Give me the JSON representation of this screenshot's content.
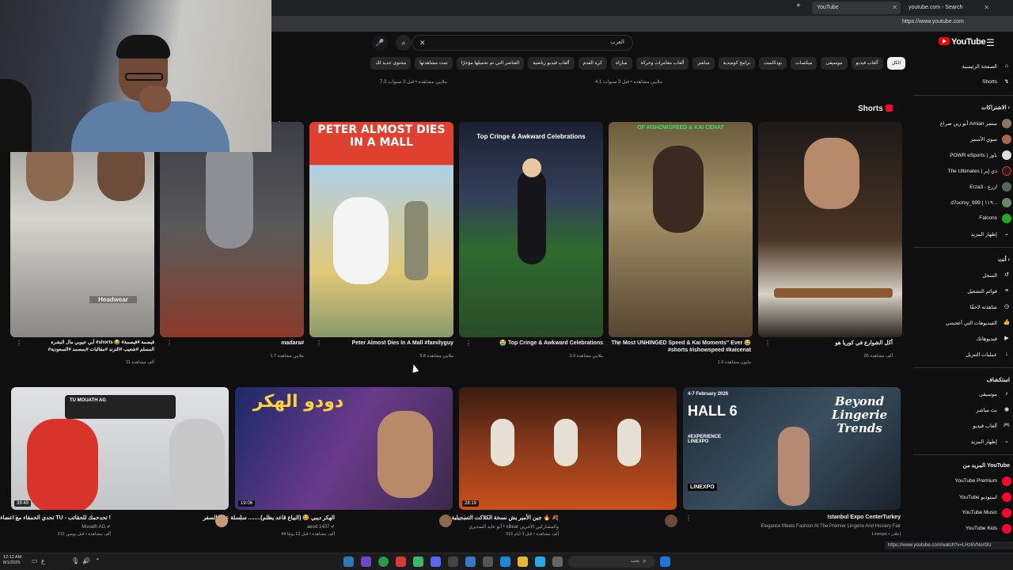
{
  "browser": {
    "tabs": [
      {
        "label": "YouTube",
        "active": true
      },
      {
        "label": "youtube.com - Search",
        "active": false
      }
    ],
    "new_tab": "+",
    "url": "https://www.youtube.com"
  },
  "header": {
    "logo": "YouTube",
    "search_value": "العرب",
    "clear_icon": "✕",
    "search_icon": "⌕",
    "mic_icon": "🎤",
    "menu_icon": "☰"
  },
  "chips": [
    {
      "label": "الكل",
      "active": true
    },
    {
      "label": "ألعاب فيديو",
      "active": false
    },
    {
      "label": "موسيقى",
      "active": false
    },
    {
      "label": "ميكسات",
      "active": false
    },
    {
      "label": "بودكاست",
      "active": false
    },
    {
      "label": "برامج كوميدية",
      "active": false
    },
    {
      "label": "مباشر",
      "active": false
    },
    {
      "label": "ألعاب مغامرات وحركة",
      "active": false
    },
    {
      "label": "مباراة",
      "active": false
    },
    {
      "label": "كرة القدم",
      "active": false
    },
    {
      "label": "ألعاب فيديو رياضية",
      "active": false
    },
    {
      "label": "العناصر التي تم تحميلها مؤخرًا",
      "active": false
    },
    {
      "label": "تمت مشاهدتها",
      "active": false
    },
    {
      "label": "محتوى جديد لك",
      "active": false
    }
  ],
  "prev_row": [
    {
      "meta": "7.3 ملايين مشاهدة • قبل 3 سنوات"
    },
    {
      "meta": "4.1 ملايين مشاهدة • قبل 3 سنوات"
    }
  ],
  "shorts": {
    "title": "Shorts",
    "fragment_label": "ents",
    "items": [
      {
        "caption": "أكل الشوارع في كوريا هو",
        "views": "95 ألف مشاهدة",
        "color": "#3a2a22"
      },
      {
        "caption": "The Most UNHINGED Speed & Kai Moments\" Ever 😂 #shorts #ishowspeed #kaicenat",
        "views": "1.6 مليون مشاهدة",
        "color": "#5b4a35"
      },
      {
        "caption": "😭 Top Cringe & Awkward Celebrations",
        "views": "3.9 ملايين مشاهدة",
        "color": "#2f4a2a",
        "overlay": "Top Cringe & Awkward Celebrations"
      },
      {
        "caption": "Peter Almost Dies In A Mall #familyguy",
        "views": "5.8 ملايين مشاهدة",
        "color": "#c9b169",
        "overlay": "PETER ALMOST DIES IN A MALL"
      },
      {
        "caption": "madara#",
        "views": "1.7 ملايين مشاهدة",
        "color": "#3b3b46"
      },
      {
        "caption": "أبي عيوبي مال البشرة #shorts 😂 #قيصمة #قيصمة",
        "caption2": "#المسلم #شعيب #الترند #مقالبات #بمصمد #السعودية",
        "views": "11 ألف مشاهدة",
        "color": "#6a6a66",
        "label": "Headwear"
      }
    ]
  },
  "videos": [
    {
      "title": "Istanbul Expo CenterTurkey",
      "channel": "Elegance Meets Fashion At The Premier Lingerie And Hosiery Fair",
      "meta": "Linexpo • إعلان",
      "duration": "",
      "color": "#2e3d4a",
      "overlay": "HALL 6",
      "overlay2": "Beyond Lingerie Trends",
      "overlay3": "4-7 February 2026",
      "overlay4": "#EXPERIENCE LINEXPO",
      "overlay5": "LINEXPO"
    },
    {
      "title": "جين الأمير يش نسخة الكلاكت التسجيلية 🔥 🍂",
      "channel": "أبو عايد السديري • xBear والمشاركين الآخرين",
      "meta": "316 ألف مشاهدة • قبل 3 أيام",
      "duration": "28:19",
      "color": "#6b3a1e"
    },
    {
      "title": "الهكر ديبي 😂 (البياع قاعد يظلم)........ سلسلة عون السفر",
      "channel": "aeod 1407 ✔",
      "meta": "44 ألف مشاهدة • قبل 12 يومًا",
      "duration": "19:06",
      "color": "#2b3a6e",
      "overlay": "دودو الهكر"
    },
    {
      "title": "تحدي الحمقاء مع اعضاء TU - تحدحمك للحقائب !",
      "channel": "Mouath AG ✔",
      "meta": "212 ألف مشاهدة • قبل يومين",
      "duration": "39:49",
      "color": "#c7c9cc",
      "overlay": "TU MOUATH AG"
    }
  ],
  "sidebar": {
    "top": [
      {
        "label": "الصفحة الرئيسية",
        "icon": "⌂"
      },
      {
        "label": "Shorts",
        "icon": "↯"
      }
    ],
    "subs_title": "الاشتراكات ›",
    "subs": [
      {
        "label": "أبو زين صراع Amian ستمر",
        "color": "#886"
      },
      {
        "label": "سوي الأسمر",
        "color": "#a64"
      },
      {
        "label": "POWR eSports | باور",
        "color": "#ddd"
      },
      {
        "label": "The Ultimates | ذي إير",
        "color": "#222"
      },
      {
        "label": "Erza3 - ازرع",
        "color": "#566"
      },
      {
        "label": "d7oomy_999 | ١١٩...",
        "color": "#686"
      },
      {
        "label": "Falcons",
        "color": "#2a2"
      },
      {
        "label": "إظهار المزيد",
        "color": "#333"
      }
    ],
    "you_title": "أنت ›",
    "you": [
      {
        "label": "السجل",
        "icon": "↺"
      },
      {
        "label": "قوائم التشغيل",
        "icon": "≡"
      },
      {
        "label": "شاهدته لاحقًا",
        "icon": "◷"
      },
      {
        "label": "الفيديوهات التي أعجبتني",
        "icon": "👍"
      },
      {
        "label": "فيديوهاتك",
        "icon": "▶"
      },
      {
        "label": "عمليات التنزيل",
        "icon": "↓"
      }
    ],
    "explore_title": "استكشاف",
    "explore": [
      {
        "label": "موسيقى",
        "icon": "♪"
      },
      {
        "label": "بث مباشر",
        "icon": "◉"
      },
      {
        "label": "ألعاب فيديو",
        "icon": "🎮"
      },
      {
        "label": "إظهار المزيد",
        "icon": "⌄"
      }
    ],
    "more_title": "المزيد من YouTube",
    "more": [
      {
        "label": "YouTube Premium",
        "color": "#ff0033"
      },
      {
        "label": "YouTube استوديو",
        "color": "#ff0033"
      },
      {
        "label": "YouTube Music",
        "color": "#ff0033"
      },
      {
        "label": "YouTube Kids",
        "color": "#ff0033"
      }
    ]
  },
  "status_url": "https://www.youtube.com/watch?v=LHz6VNorl3U",
  "taskbar": {
    "search_placeholder": "بحث",
    "time": "12:12 AM",
    "date": "8/1/2025"
  }
}
